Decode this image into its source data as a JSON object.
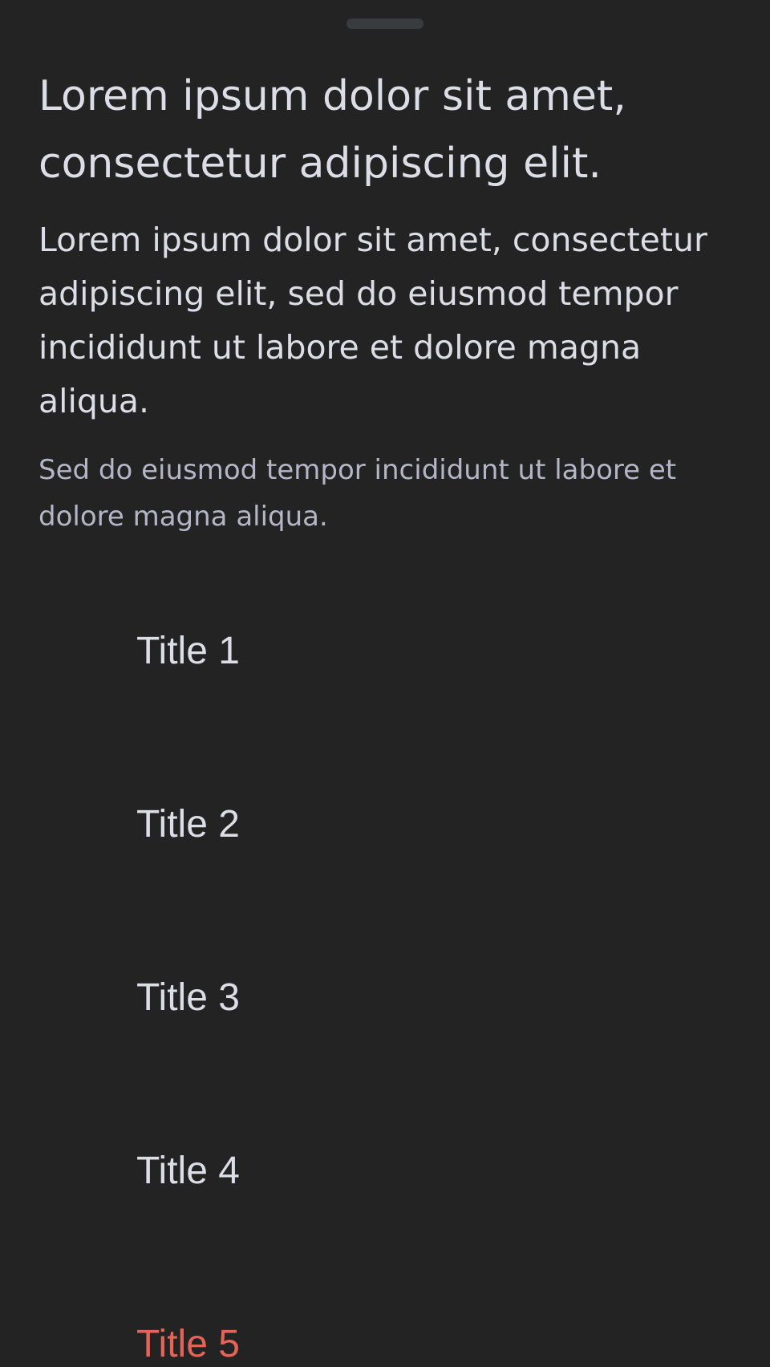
{
  "sheet": {
    "headline": "Lorem ipsum dolor sit amet, consectetur adipiscing elit.",
    "body": "Lorem ipsum dolor sit amet, consectetur adipiscing elit, sed do eiusmod tempor incididunt ut labore et dolore magna aliqua.",
    "caption": "Sed do eiusmod tempor incididunt ut labore et dolore magna aliqua."
  },
  "menu": {
    "items": [
      {
        "label": "Title 1"
      },
      {
        "label": "Title 2"
      },
      {
        "label": "Title 3"
      },
      {
        "label": "Title 4"
      },
      {
        "label": "Title 5",
        "color": "#e5645a"
      }
    ]
  },
  "colors": {
    "background": "#232323",
    "text": "#dcdde6",
    "secondary_text": "#b4b6c8",
    "destructive": "#e5645a",
    "handle": "#3a3b3f"
  }
}
